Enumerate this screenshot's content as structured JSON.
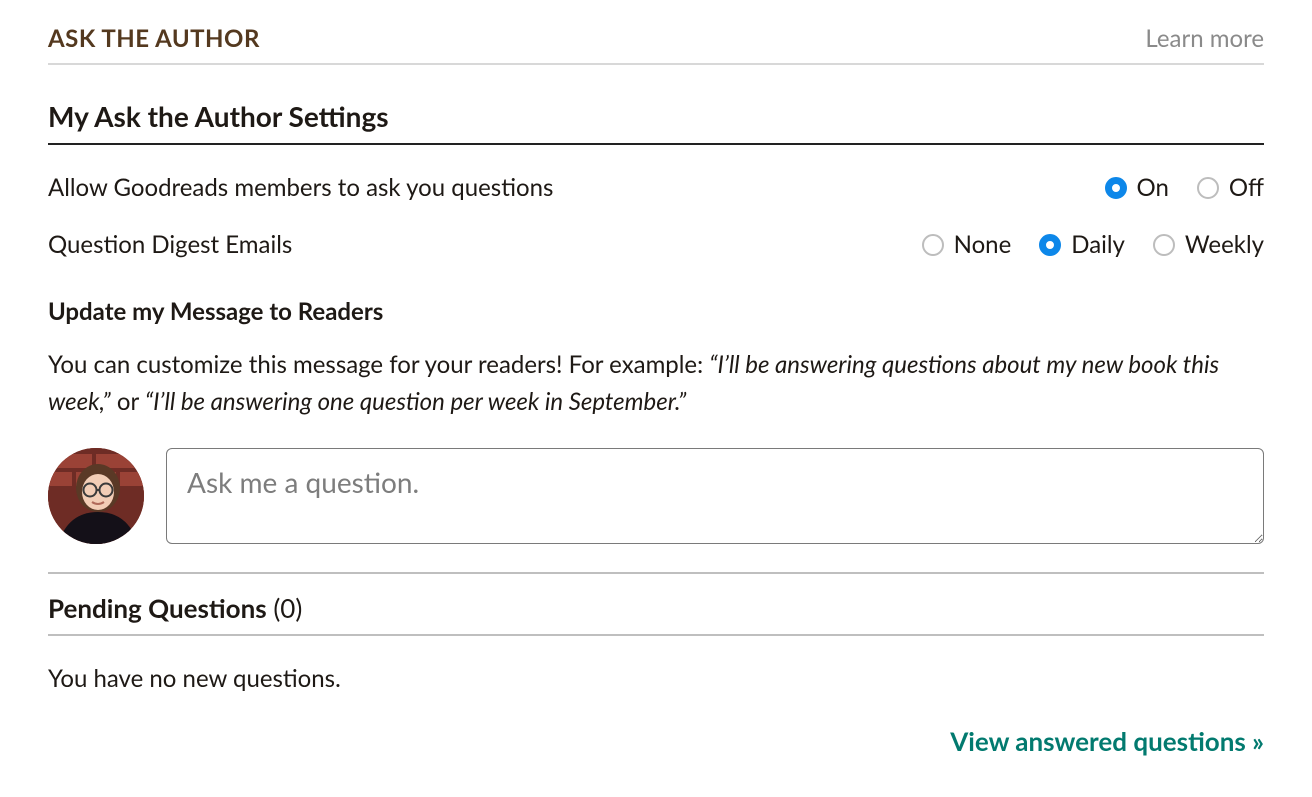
{
  "header": {
    "title": "ASK THE AUTHOR",
    "learn_more": "Learn more"
  },
  "settings": {
    "title": "My Ask the Author Settings",
    "allow_questions": {
      "label": "Allow Goodreads members to ask you questions",
      "options": {
        "on": "On",
        "off": "Off"
      },
      "selected": "on"
    },
    "digest": {
      "label": "Question Digest Emails",
      "options": {
        "none": "None",
        "daily": "Daily",
        "weekly": "Weekly"
      },
      "selected": "daily"
    },
    "update_heading": "Update my Message to Readers",
    "help_pre": "You can customize this message for your readers! For example: ",
    "help_example1": "“I’ll be answering questions about my new book this week,”",
    "help_or": " or ",
    "help_example2": "“I’ll be answering one question per week in September.”",
    "textarea_placeholder": "Ask me a question.",
    "textarea_value": ""
  },
  "pending": {
    "title": "Pending Questions",
    "count_display": "(0)",
    "empty": "You have no new questions."
  },
  "footer": {
    "view_answered": "View answered questions »"
  }
}
